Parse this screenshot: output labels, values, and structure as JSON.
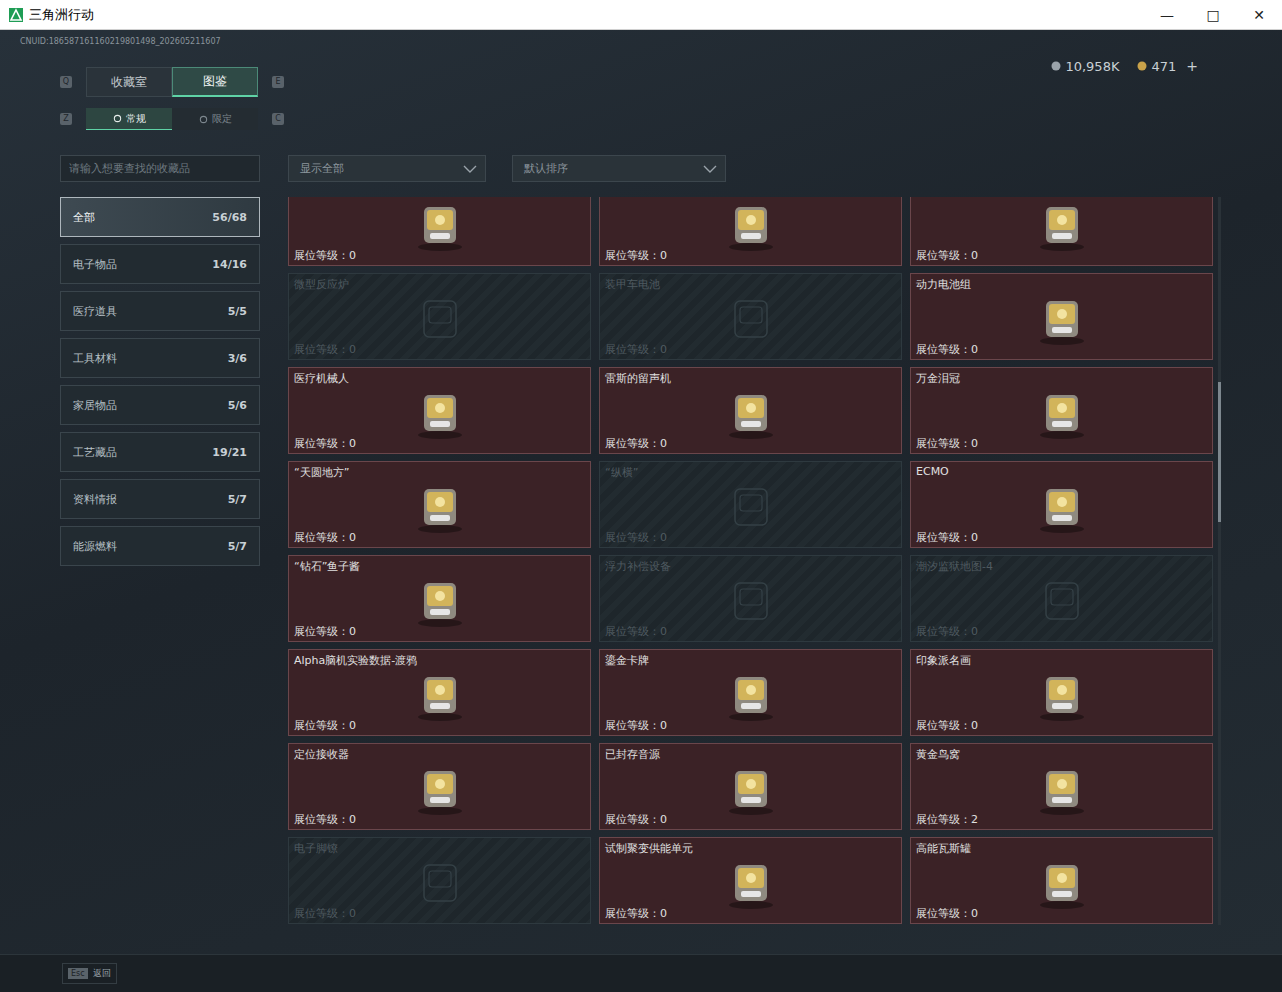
{
  "window": {
    "title": "三角洲行动",
    "controls": [
      "—",
      "□",
      "✕"
    ]
  },
  "uid": "CNUID:186587161160219801498_202605211607",
  "currency": [
    {
      "value": "10,958K",
      "suffix": ""
    },
    {
      "value": "471",
      "suffix": "+"
    }
  ],
  "main_tabs": {
    "keys": [
      "Q",
      "E"
    ],
    "items": [
      {
        "label": "收藏室",
        "selected": false
      },
      {
        "label": "图鉴",
        "selected": true
      }
    ]
  },
  "sub_tabs": {
    "keys": [
      "Z",
      "C"
    ],
    "items": [
      {
        "label": "常规",
        "selected": true
      },
      {
        "label": "限定",
        "selected": false
      }
    ]
  },
  "search": {
    "placeholder": "请输入想要查找的收藏品"
  },
  "filters": [
    {
      "value": "显示全部"
    },
    {
      "value": "默认排序"
    }
  ],
  "categories": [
    {
      "name": "全部",
      "count": "56/68",
      "selected": true
    },
    {
      "name": "电子物品",
      "count": "14/16",
      "selected": false
    },
    {
      "name": "医疗道具",
      "count": "5/5",
      "selected": false
    },
    {
      "name": "工具材料",
      "count": "3/6",
      "selected": false
    },
    {
      "name": "家居物品",
      "count": "5/6",
      "selected": false
    },
    {
      "name": "工艺藏品",
      "count": "19/21",
      "selected": false
    },
    {
      "name": "资料情报",
      "count": "5/7",
      "selected": false
    },
    {
      "name": "能源燃料",
      "count": "5/7",
      "selected": false
    }
  ],
  "items": [
    {
      "name": "",
      "collected": true,
      "label": "展位等级：",
      "rank": "0"
    },
    {
      "name": "",
      "collected": true,
      "label": "展位等级：",
      "rank": "0"
    },
    {
      "name": "",
      "collected": true,
      "label": "展位等级：",
      "rank": "0"
    },
    {
      "name": "微型反应炉",
      "collected": false,
      "label": "展位等级：",
      "rank": "0"
    },
    {
      "name": "装甲车电池",
      "collected": false,
      "label": "展位等级：",
      "rank": "0"
    },
    {
      "name": "动力电池组",
      "collected": true,
      "label": "展位等级：",
      "rank": "0"
    },
    {
      "name": "医疗机械人",
      "collected": true,
      "label": "展位等级：",
      "rank": "0"
    },
    {
      "name": "雷斯的留声机",
      "collected": true,
      "label": "展位等级：",
      "rank": "0"
    },
    {
      "name": "万金泪冠",
      "collected": true,
      "label": "展位等级：",
      "rank": "0"
    },
    {
      "name": "“天圆地方”",
      "collected": true,
      "label": "展位等级：",
      "rank": "0"
    },
    {
      "name": "“纵横”",
      "collected": false,
      "label": "展位等级：",
      "rank": "0"
    },
    {
      "name": "ECMO",
      "collected": true,
      "label": "展位等级：",
      "rank": "0"
    },
    {
      "name": "“钻石”鱼子酱",
      "collected": true,
      "label": "展位等级：",
      "rank": "0"
    },
    {
      "name": "浮力补偿设备",
      "collected": false,
      "label": "展位等级：",
      "rank": "0"
    },
    {
      "name": "潮汐监狱地图-4",
      "collected": false,
      "label": "展位等级：",
      "rank": "0"
    },
    {
      "name": "Alpha脑机实验数据-渡鸦",
      "collected": true,
      "label": "展位等级：",
      "rank": "0"
    },
    {
      "name": "鎏金卡牌",
      "collected": true,
      "label": "展位等级：",
      "rank": "0"
    },
    {
      "name": "印象派名画",
      "collected": true,
      "label": "展位等级：",
      "rank": "0"
    },
    {
      "name": "定位接收器",
      "collected": true,
      "label": "展位等级：",
      "rank": "0"
    },
    {
      "name": "已封存音源",
      "collected": true,
      "label": "展位等级：",
      "rank": "0"
    },
    {
      "name": "黄金鸟窝",
      "collected": true,
      "label": "展位等级：",
      "rank": "2"
    },
    {
      "name": "电子脚镣",
      "collected": false,
      "label": "展位等级：",
      "rank": "0"
    },
    {
      "name": "试制聚变供能单元",
      "collected": true,
      "label": "展位等级：",
      "rank": "0"
    },
    {
      "name": "高能瓦斯罐",
      "collected": true,
      "label": "展位等级：",
      "rank": "0"
    }
  ],
  "footer": {
    "key": "Esc",
    "label": "返回"
  }
}
